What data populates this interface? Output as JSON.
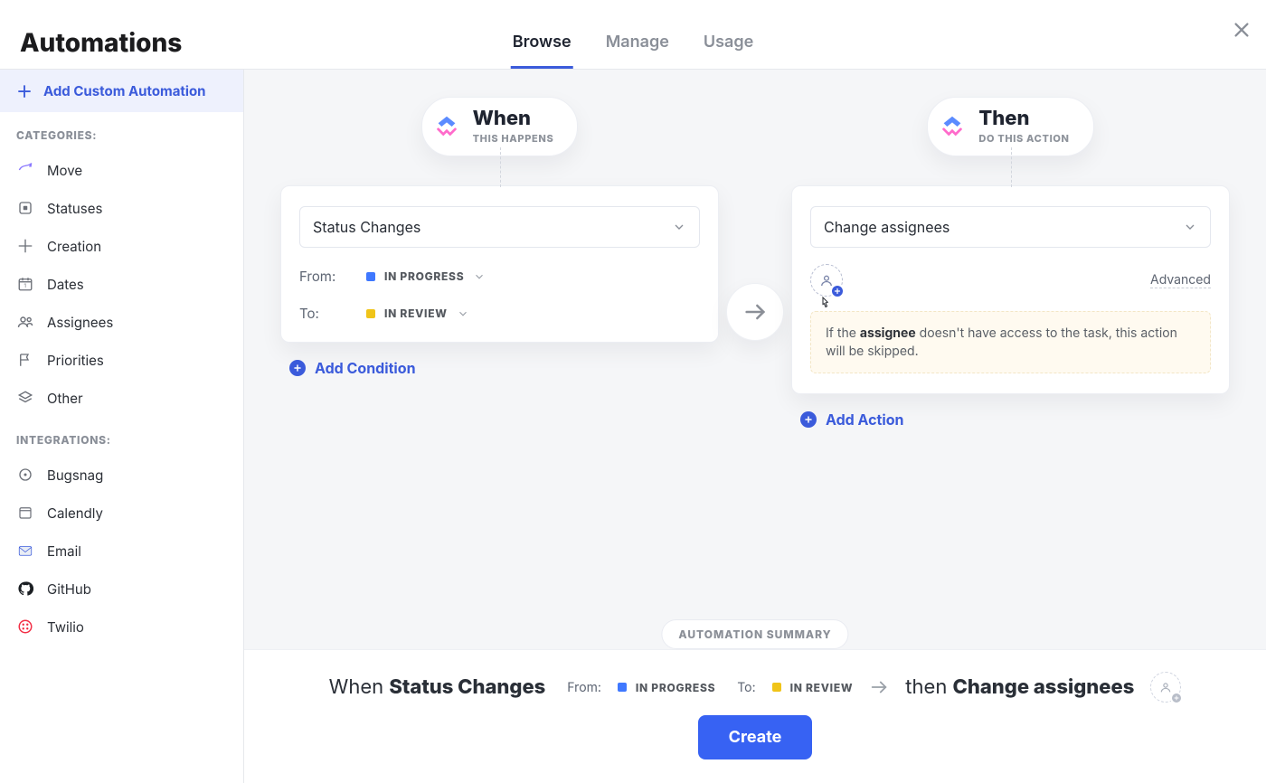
{
  "header": {
    "title": "Automations",
    "tabs": [
      {
        "label": "Browse",
        "active": true
      },
      {
        "label": "Manage",
        "active": false
      },
      {
        "label": "Usage",
        "active": false
      }
    ]
  },
  "sidebar": {
    "add_label": "Add Custom Automation",
    "categories_label": "CATEGORIES:",
    "categories": [
      {
        "label": "Move",
        "icon": "share-arrow-icon"
      },
      {
        "label": "Statuses",
        "icon": "square-dot-icon"
      },
      {
        "label": "Creation",
        "icon": "plus-cross-icon"
      },
      {
        "label": "Dates",
        "icon": "calendar-icon"
      },
      {
        "label": "Assignees",
        "icon": "people-icon"
      },
      {
        "label": "Priorities",
        "icon": "flag-icon"
      },
      {
        "label": "Other",
        "icon": "layers-icon"
      }
    ],
    "integrations_label": "INTEGRATIONS:",
    "integrations": [
      {
        "label": "Bugsnag",
        "icon": "bugsnag-icon"
      },
      {
        "label": "Calendly",
        "icon": "calendly-icon"
      },
      {
        "label": "Email",
        "icon": "email-icon"
      },
      {
        "label": "GitHub",
        "icon": "github-icon"
      },
      {
        "label": "Twilio",
        "icon": "twilio-icon"
      }
    ]
  },
  "builder": {
    "when": {
      "title": "When",
      "subtitle": "THIS HAPPENS",
      "trigger_select": "Status Changes",
      "from_label": "From:",
      "from_status": "IN PROGRESS",
      "to_label": "To:",
      "to_status": "IN REVIEW",
      "add_condition_label": "Add Condition"
    },
    "then": {
      "title": "Then",
      "subtitle": "DO THIS ACTION",
      "action_select": "Change assignees",
      "advanced_label": "Advanced",
      "note_pre": "If the ",
      "note_strong": "assignee",
      "note_post": " doesn't have access to the task, this action will be skipped.",
      "add_action_label": "Add Action"
    }
  },
  "summary": {
    "pill": "AUTOMATION SUMMARY",
    "when_word": "When ",
    "when_strong": "Status Changes",
    "from_label": "From:",
    "from_status": "IN PROGRESS",
    "to_label": "To:",
    "to_status": "IN REVIEW",
    "then_word": "then ",
    "then_strong": "Change assignees"
  },
  "cta": {
    "create": "Create"
  }
}
